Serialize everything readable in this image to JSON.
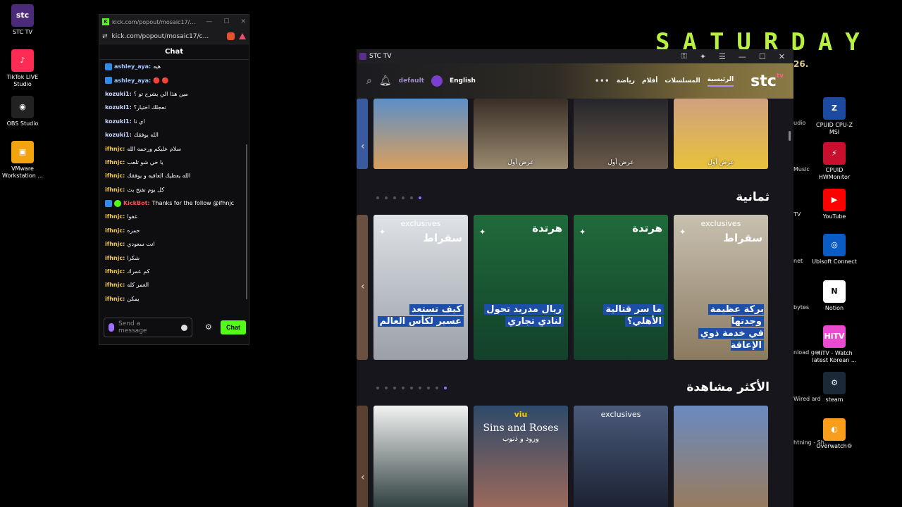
{
  "desktop": {
    "left_icons": [
      {
        "label": "STC TV",
        "icon": "stc-tv-icon",
        "color": "#4b2a7a",
        "glyph": "stc"
      },
      {
        "label": "TikTok LIVE Studio",
        "icon": "tiktok-icon",
        "color": "#fe2c55",
        "glyph": "♪"
      },
      {
        "label": "OBS Studio",
        "icon": "obs-icon",
        "color": "#222222",
        "glyph": "◉"
      },
      {
        "label": "VMware Workstation ...",
        "icon": "vmware-icon",
        "color": "#f1a40f",
        "glyph": "▣"
      }
    ],
    "right_icons": [
      {
        "label": "CPUID CPU-Z MSI",
        "icon": "cpuz-icon",
        "color": "#1c4aa0",
        "glyph": "Z"
      },
      {
        "label": "CPUID HWMonitor",
        "icon": "hwmonitor-icon",
        "color": "#c8102e",
        "glyph": "⚡"
      },
      {
        "label": "YouTube",
        "icon": "youtube-icon",
        "color": "#ff0000",
        "glyph": "▶"
      },
      {
        "label": "Ubisoft Connect",
        "icon": "ubisoft-icon",
        "color": "#0a5bc4",
        "glyph": "◎"
      },
      {
        "label": "Notion",
        "icon": "notion-icon",
        "color": "#ffffff",
        "glyph": "N"
      },
      {
        "label": "HiTV - Watch latest Korean ...",
        "icon": "hitv-icon",
        "color": "#e94ad0",
        "glyph": "HiTV"
      },
      {
        "label": "steam",
        "icon": "steam-icon",
        "color": "#1b2838",
        "glyph": "⚙"
      },
      {
        "label": "Overwatch®",
        "icon": "overwatch-icon",
        "color": "#f99e1a",
        "glyph": "◐"
      }
    ],
    "partial_labels": [
      "udio",
      "Music",
      "TV",
      "net",
      "bytes",
      "nload ger",
      "Wired ard",
      "htning - Sh..."
    ],
    "wallpaper_text": "SATURDAY",
    "date_fragment": "26."
  },
  "chat_window": {
    "url_title": "kick.com/popout/mosaic17/...",
    "url": "kick.com/popout/mosaic17/c...",
    "header": "Chat",
    "messages": [
      {
        "user": "ashley_aya:",
        "text": "هيه",
        "badge": true,
        "color": "#9fc6ff"
      },
      {
        "user": "ashley_aya:",
        "text": "🔴 🔴",
        "badge": true,
        "color": "#9fc6ff"
      },
      {
        "user": "kozuki1:",
        "text": "مين هذا الي يشرح تو ؟",
        "badge": false,
        "color": "#c9d7ff"
      },
      {
        "user": "kozuki1:",
        "text": "نعجلك اختيار؟",
        "badge": false,
        "color": "#c9d7ff"
      },
      {
        "user": "kozuki1:",
        "text": "اي نا",
        "badge": false,
        "color": "#c9d7ff"
      },
      {
        "user": "kozuki1:",
        "text": "الله يوفقك",
        "badge": false,
        "color": "#c9d7ff"
      },
      {
        "user": "ifhnjc:",
        "text": "سلام عليكم ورحمه الله",
        "badge": false,
        "color": "#f2c94c"
      },
      {
        "user": "ifhnjc:",
        "text": "يا خي شو تلعب",
        "badge": false,
        "color": "#f2c94c"
      },
      {
        "user": "ifhnjc:",
        "text": "الله يعطيك العافيه و يوفقك",
        "badge": false,
        "color": "#f2c94c"
      },
      {
        "user": "ifhnjc:",
        "text": "كل يوم تفتح بث",
        "badge": false,
        "color": "#f2c94c"
      },
      {
        "user": "KickBot:",
        "text": "Thanks for the follow @ifhnjc",
        "badge": true,
        "bot": true,
        "color": "#ff4f4f"
      },
      {
        "user": "ifhnjc:",
        "text": "عفوا",
        "badge": false,
        "color": "#f2c94c"
      },
      {
        "user": "ifhnjc:",
        "text": "حمزه",
        "badge": false,
        "color": "#f2c94c"
      },
      {
        "user": "ifhnjc:",
        "text": "انت سعودي",
        "badge": false,
        "color": "#f2c94c"
      },
      {
        "user": "ifhnjc:",
        "text": "شكرا",
        "badge": false,
        "color": "#f2c94c"
      },
      {
        "user": "ifhnjc:",
        "text": "كم عمرك",
        "badge": false,
        "color": "#f2c94c"
      },
      {
        "user": "ifhnjc:",
        "text": "العمر كله",
        "badge": false,
        "color": "#f2c94c"
      },
      {
        "user": "ifhnjc:",
        "text": "يمكن",
        "badge": false,
        "color": "#f2c94c"
      }
    ],
    "input_placeholder": "Send a message",
    "send_label": "Chat"
  },
  "stc_window": {
    "title": "STC TV",
    "nav": {
      "profile": "default",
      "language": "English",
      "items": [
        "رياضة",
        "أفلام",
        "المسلسلات",
        "الرئيسية"
      ],
      "active_item": "الرئيسية",
      "brand": "stc",
      "brand_sup": "tv"
    },
    "row1_captions": [
      "",
      "عرض أول",
      "عرض أول",
      "عرض أول"
    ],
    "section2": {
      "title": "ثمانية",
      "cards": [
        {
          "badge": "exclusives",
          "show": "سقراط",
          "title_lines": [
            "كيف تستعد",
            "عسير لكأس العالم"
          ]
        },
        {
          "badge": "",
          "show": "هرتدة",
          "title_lines": [
            "ريال مدريد تحول",
            "لنادي تجاري"
          ]
        },
        {
          "badge": "",
          "show": "هرتدة",
          "title_lines": [
            "ما سر قتالية",
            "الأهلي؟"
          ]
        },
        {
          "badge": "exclusives",
          "show": "سقراط",
          "title_lines": [
            "بركة عظيمة وجدتها",
            "في خدمة ذوي الإعاقة"
          ]
        }
      ]
    },
    "section3": {
      "title": "الأكثر مشاهدة",
      "cards": [
        {
          "badge": ""
        },
        {
          "badge": "viu",
          "title": "Sins and Roses",
          "subtitle": "ورود و ذنوب"
        },
        {
          "badge": "exclusives"
        },
        {
          "badge": ""
        }
      ]
    }
  }
}
